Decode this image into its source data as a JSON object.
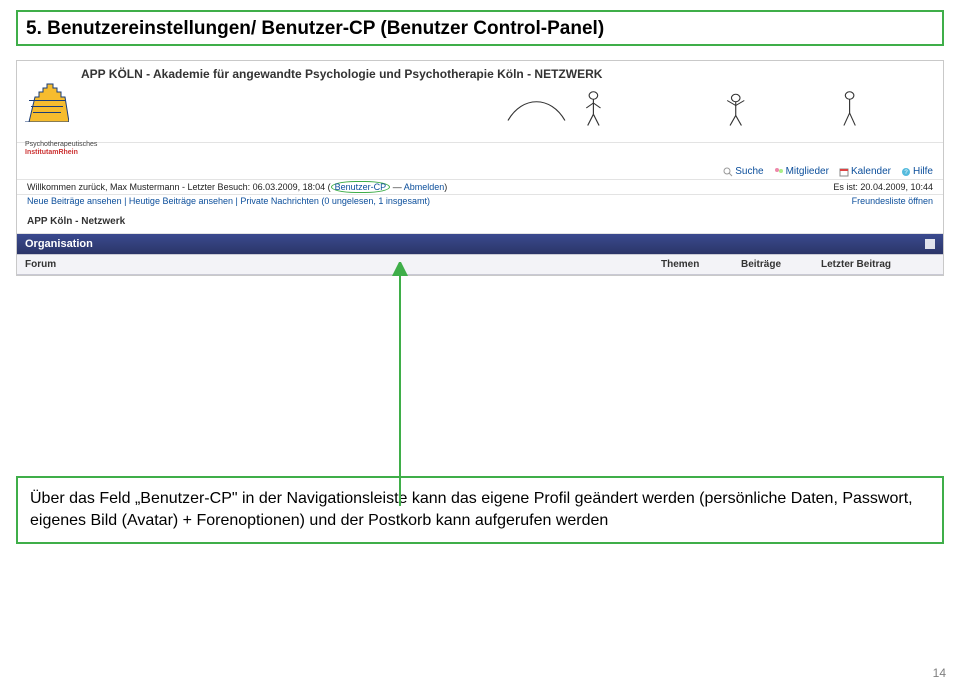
{
  "title": "5. Benutzereinstellungen/ Benutzer-CP (Benutzer Control-Panel)",
  "screenshot": {
    "institut_line1": "Psychotherapeutisches",
    "institut_line2": "InstitutamRhein",
    "site_title": "APP KÖLN - Akademie für angewandte Psychologie und Psychotherapie Köln - NETZWERK",
    "tools": {
      "suche": "Suche",
      "mitglieder": "Mitglieder",
      "kalender": "Kalender",
      "hilfe": "Hilfe"
    },
    "welcome_prefix": "Willkommen zurück, ",
    "welcome_user": "Max Mustermann",
    "welcome_mid": " - Letzter Besuch: 06.03.2009, 18:04 (",
    "cp_label": "Benutzer-CP",
    "welcome_sep": " — ",
    "logout": "Abmelden",
    "welcome_suffix": ")",
    "time_line": "Es ist: 20.04.2009, 10:44",
    "sublinks": {
      "neue": "Neue Beiträge ansehen",
      "heutige": "Heutige Beiträge ansehen",
      "pm": "Private Nachrichten (0 ungelesen, 1 insgesamt)",
      "friends": "Freundesliste öffnen"
    },
    "breadcrumb": "APP Köln - Netzwerk",
    "org_label": "Organisation",
    "table_headers": {
      "forum": "Forum",
      "themen": "Themen",
      "beitraege": "Beiträge",
      "letzter": "Letzter Beitrag"
    }
  },
  "description": "Über das Feld „Benutzer-CP\" in der Navigationsleiste kann das eigene Profil geändert werden (persönliche Daten, Passwort, eigenes Bild (Avatar) + Forenoptionen) und der Postkorb kann aufgerufen werden",
  "page_number": "14"
}
